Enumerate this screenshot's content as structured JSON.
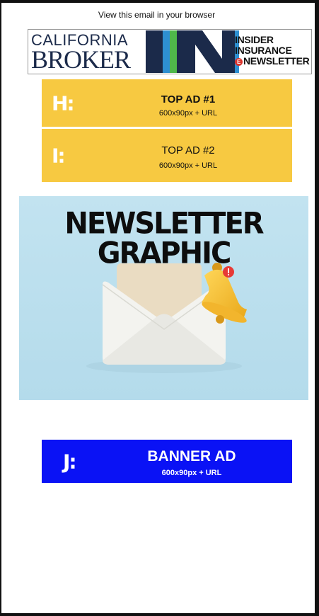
{
  "header": {
    "view_in_browser": "View this email in your browser"
  },
  "masthead": {
    "california": "CALIFORNIA",
    "broker": "BROKER",
    "in_logo": "IN",
    "insider": "INSIDER",
    "insurance": "INSURANCE",
    "e_badge": "E",
    "newsletter": "NEWSLETTER"
  },
  "ads": {
    "top1": {
      "code": "H:",
      "title": "TOP AD #1",
      "subtitle": "600x90px + URL"
    },
    "top2": {
      "code": "I:",
      "title": "TOP AD #2",
      "subtitle": "600x90px + URL"
    },
    "banner": {
      "code": "J:",
      "title": "BANNER AD",
      "subtitle": "600x90px + URL"
    }
  },
  "graphic": {
    "line1": "NEWSLETTER",
    "line2": "GRAPHIC",
    "icons": [
      "envelope-icon",
      "bell-icon",
      "notification-badge-icon"
    ]
  },
  "colors": {
    "ad_yellow": "#f7c941",
    "banner_blue": "#0a12f5",
    "graphic_bg": "#bcdfed",
    "logo_navy": "#1b2a4a"
  }
}
